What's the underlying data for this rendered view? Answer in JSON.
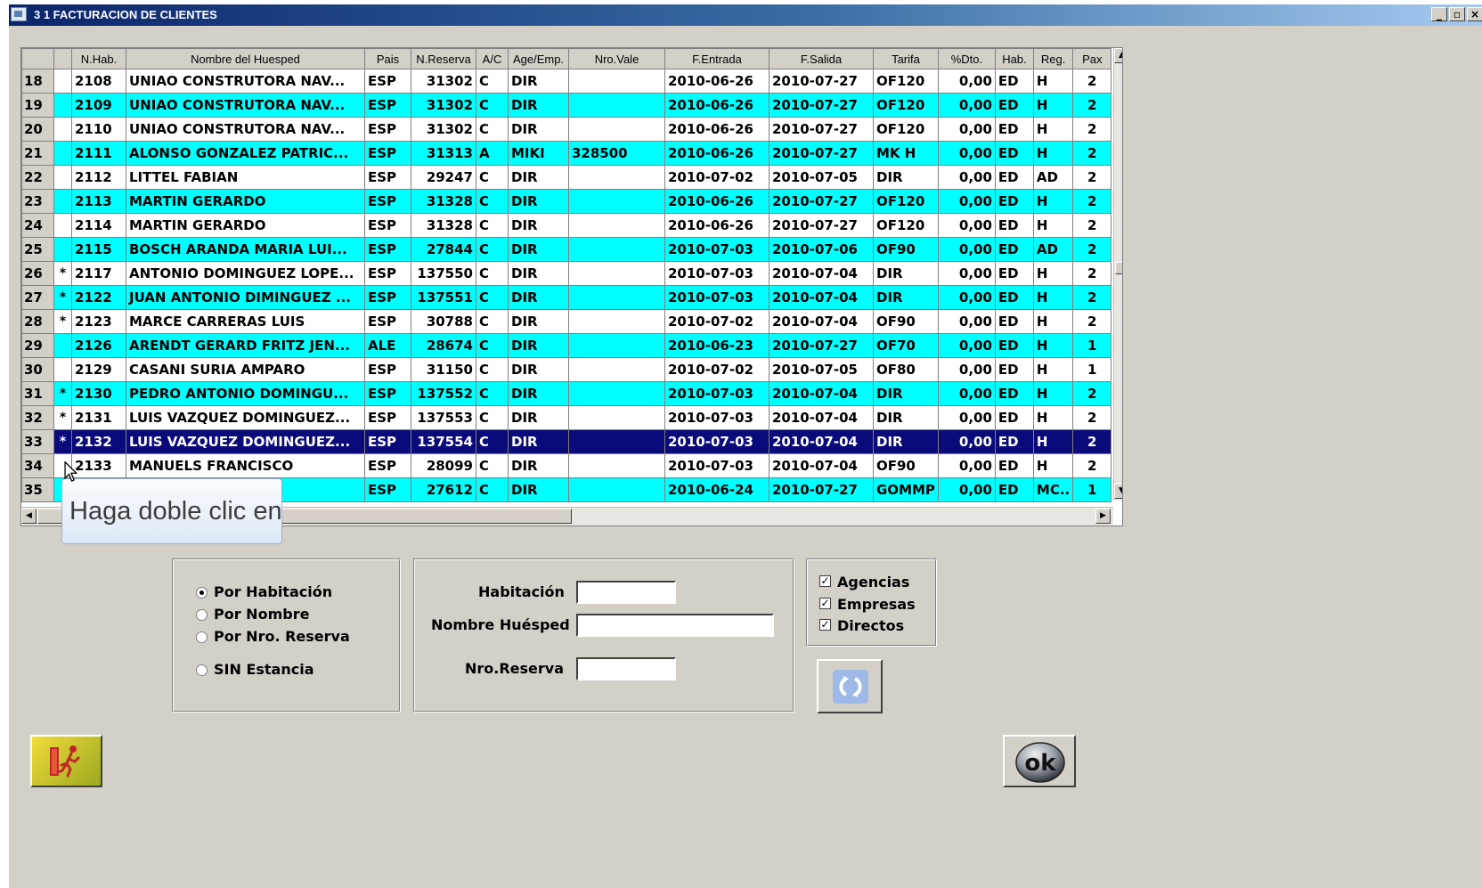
{
  "window": {
    "title": "3 1 FACTURACION DE CLIENTES",
    "controls": {
      "minimize": "_",
      "restore": "▫",
      "close": "×"
    }
  },
  "grid": {
    "columns": [
      "",
      "N.Hab.",
      "Nombre del Huesped",
      "Pais",
      "N.Reserva",
      "A/C",
      "Age/Emp.",
      "Nro.Vale",
      "F.Entrada",
      "F.Salida",
      "Tarifa",
      "%Dto.",
      "Hab.",
      "Reg.",
      "Pax"
    ],
    "rows": [
      {
        "n": "18",
        "mark": "",
        "hab": "2108",
        "name": "UNIAO CONSTRUTORA NAV...",
        "pais": "ESP",
        "res": "31302",
        "ac": "C",
        "age": "DIR",
        "vale": "",
        "fin": "2010-06-26",
        "fout": "2010-07-27",
        "tarifa": "OF120",
        "dto": "0,00",
        "thab": "ED",
        "reg": "H",
        "pax": "2"
      },
      {
        "n": "19",
        "mark": "",
        "hab": "2109",
        "name": "UNIAO CONSTRUTORA NAV...",
        "pais": "ESP",
        "res": "31302",
        "ac": "C",
        "age": "DIR",
        "vale": "",
        "fin": "2010-06-26",
        "fout": "2010-07-27",
        "tarifa": "OF120",
        "dto": "0,00",
        "thab": "ED",
        "reg": "H",
        "pax": "2"
      },
      {
        "n": "20",
        "mark": "",
        "hab": "2110",
        "name": "UNIAO CONSTRUTORA NAV...",
        "pais": "ESP",
        "res": "31302",
        "ac": "C",
        "age": "DIR",
        "vale": "",
        "fin": "2010-06-26",
        "fout": "2010-07-27",
        "tarifa": "OF120",
        "dto": "0,00",
        "thab": "ED",
        "reg": "H",
        "pax": "2"
      },
      {
        "n": "21",
        "mark": "",
        "hab": "2111",
        "name": "ALONSO GONZALEZ PATRIC...",
        "pais": "ESP",
        "res": "31313",
        "ac": "A",
        "age": "MIKI",
        "vale": "328500",
        "fin": "2010-06-26",
        "fout": "2010-07-27",
        "tarifa": "MK H",
        "dto": "0,00",
        "thab": "ED",
        "reg": "H",
        "pax": "2"
      },
      {
        "n": "22",
        "mark": "",
        "hab": "2112",
        "name": "LITTEL FABIAN",
        "pais": "ESP",
        "res": "29247",
        "ac": "C",
        "age": "DIR",
        "vale": "",
        "fin": "2010-07-02",
        "fout": "2010-07-05",
        "tarifa": "DIR",
        "dto": "0,00",
        "thab": "ED",
        "reg": "AD",
        "pax": "2"
      },
      {
        "n": "23",
        "mark": "",
        "hab": "2113",
        "name": "MARTIN GERARDO",
        "pais": "ESP",
        "res": "31328",
        "ac": "C",
        "age": "DIR",
        "vale": "",
        "fin": "2010-06-26",
        "fout": "2010-07-27",
        "tarifa": "OF120",
        "dto": "0,00",
        "thab": "ED",
        "reg": "H",
        "pax": "2"
      },
      {
        "n": "24",
        "mark": "",
        "hab": "2114",
        "name": "MARTIN GERARDO",
        "pais": "ESP",
        "res": "31328",
        "ac": "C",
        "age": "DIR",
        "vale": "",
        "fin": "2010-06-26",
        "fout": "2010-07-27",
        "tarifa": "OF120",
        "dto": "0,00",
        "thab": "ED",
        "reg": "H",
        "pax": "2"
      },
      {
        "n": "25",
        "mark": "",
        "hab": "2115",
        "name": "BOSCH ARANDA MARIA LUI...",
        "pais": "ESP",
        "res": "27844",
        "ac": "C",
        "age": "DIR",
        "vale": "",
        "fin": "2010-07-03",
        "fout": "2010-07-06",
        "tarifa": "OF90",
        "dto": "0,00",
        "thab": "ED",
        "reg": "AD",
        "pax": "2"
      },
      {
        "n": "26",
        "mark": "*",
        "hab": "2117",
        "name": "ANTONIO DOMINGUEZ LOPE...",
        "pais": "ESP",
        "res": "137550",
        "ac": "C",
        "age": "DIR",
        "vale": "",
        "fin": "2010-07-03",
        "fout": "2010-07-04",
        "tarifa": "DIR",
        "dto": "0,00",
        "thab": "ED",
        "reg": "H",
        "pax": "2"
      },
      {
        "n": "27",
        "mark": "*",
        "hab": "2122",
        "name": "JUAN ANTONIO DIMINGUEZ ...",
        "pais": "ESP",
        "res": "137551",
        "ac": "C",
        "age": "DIR",
        "vale": "",
        "fin": "2010-07-03",
        "fout": "2010-07-04",
        "tarifa": "DIR",
        "dto": "0,00",
        "thab": "ED",
        "reg": "H",
        "pax": "2"
      },
      {
        "n": "28",
        "mark": "*",
        "hab": "2123",
        "name": "MARCE CARRERAS LUIS",
        "pais": "ESP",
        "res": "30788",
        "ac": "C",
        "age": "DIR",
        "vale": "",
        "fin": "2010-07-02",
        "fout": "2010-07-04",
        "tarifa": "OF90",
        "dto": "0,00",
        "thab": "ED",
        "reg": "H",
        "pax": "2"
      },
      {
        "n": "29",
        "mark": "",
        "hab": "2126",
        "name": "ARENDT GERARD FRITZ JEN...",
        "pais": "ALE",
        "res": "28674",
        "ac": "C",
        "age": "DIR",
        "vale": "",
        "fin": "2010-06-23",
        "fout": "2010-07-27",
        "tarifa": "OF70",
        "dto": "0,00",
        "thab": "ED",
        "reg": "H",
        "pax": "1"
      },
      {
        "n": "30",
        "mark": "",
        "hab": "2129",
        "name": "CASANI SURIA AMPARO",
        "pais": "ESP",
        "res": "31150",
        "ac": "C",
        "age": "DIR",
        "vale": "",
        "fin": "2010-07-02",
        "fout": "2010-07-05",
        "tarifa": "OF80",
        "dto": "0,00",
        "thab": "ED",
        "reg": "H",
        "pax": "1"
      },
      {
        "n": "31",
        "mark": "*",
        "hab": "2130",
        "name": "PEDRO ANTONIO DOMINGU...",
        "pais": "ESP",
        "res": "137552",
        "ac": "C",
        "age": "DIR",
        "vale": "",
        "fin": "2010-07-03",
        "fout": "2010-07-04",
        "tarifa": "DIR",
        "dto": "0,00",
        "thab": "ED",
        "reg": "H",
        "pax": "2"
      },
      {
        "n": "32",
        "mark": "*",
        "hab": "2131",
        "name": "LUIS VAZQUEZ DOMINGUEZ...",
        "pais": "ESP",
        "res": "137553",
        "ac": "C",
        "age": "DIR",
        "vale": "",
        "fin": "2010-07-03",
        "fout": "2010-07-04",
        "tarifa": "DIR",
        "dto": "0,00",
        "thab": "ED",
        "reg": "H",
        "pax": "2"
      },
      {
        "n": "33",
        "mark": "*",
        "hab": "2132",
        "name": "LUIS VAZQUEZ DOMINGUEZ...",
        "pais": "ESP",
        "res": "137554",
        "ac": "C",
        "age": "DIR",
        "vale": "",
        "fin": "2010-07-03",
        "fout": "2010-07-04",
        "tarifa": "DIR",
        "dto": "0,00",
        "thab": "ED",
        "reg": "H",
        "pax": "2"
      },
      {
        "n": "34",
        "mark": "",
        "hab": "2133",
        "name": "MANUELS FRANCISCO",
        "pais": "ESP",
        "res": "28099",
        "ac": "C",
        "age": "DIR",
        "vale": "",
        "fin": "2010-07-03",
        "fout": "2010-07-04",
        "tarifa": "OF90",
        "dto": "0,00",
        "thab": "ED",
        "reg": "H",
        "pax": "2"
      },
      {
        "n": "35",
        "mark": "",
        "hab": "",
        "name": "",
        "pais": "ESP",
        "res": "27612",
        "ac": "C",
        "age": "DIR",
        "vale": "",
        "fin": "2010-06-24",
        "fout": "2010-07-27",
        "tarifa": "GOMMP",
        "dto": "0,00",
        "thab": "ED",
        "reg": "MC..",
        "pax": "1"
      }
    ],
    "selected_row": "33",
    "colors": {
      "row_cyan": "#00ffff",
      "row_white": "#ffffff",
      "row_selected": "#0a0a7a"
    }
  },
  "tooltip": {
    "text": "Haga doble clic en"
  },
  "search_options": {
    "radios": [
      {
        "label": "Por Habitación",
        "selected": true
      },
      {
        "label": "Por Nombre",
        "selected": false
      },
      {
        "label": "Por Nro. Reserva",
        "selected": false
      },
      {
        "label": "SIN Estancia",
        "selected": false
      }
    ]
  },
  "search_fields": {
    "habitacion": {
      "label": "Habitación",
      "value": ""
    },
    "nombre": {
      "label": "Nombre Huésped",
      "value": ""
    },
    "reserva": {
      "label": "Nro.Reserva",
      "value": ""
    }
  },
  "filters": {
    "agencias": {
      "label": "Agencias",
      "checked": true
    },
    "empresas": {
      "label": "Empresas",
      "checked": true
    },
    "directos": {
      "label": "Directos",
      "checked": true
    }
  },
  "buttons": {
    "refresh": "refresh-icon",
    "exit": "exit-icon",
    "ok": "ok"
  }
}
